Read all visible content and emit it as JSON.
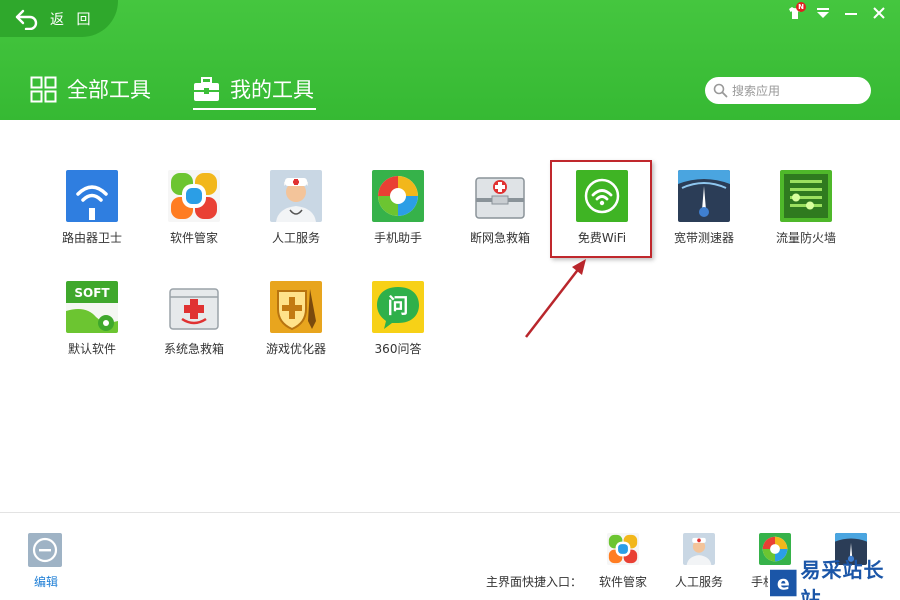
{
  "header": {
    "back_label": "返 回",
    "tabs": [
      {
        "label": "全部工具",
        "active": false
      },
      {
        "label": "我的工具",
        "active": true
      }
    ],
    "search": {
      "placeholder": "搜索应用"
    },
    "notification_badge": "N"
  },
  "tools": [
    {
      "label": "路由器卫士",
      "icon": "router-guard-icon"
    },
    {
      "label": "软件管家",
      "icon": "software-manager-icon"
    },
    {
      "label": "人工服务",
      "icon": "human-service-icon"
    },
    {
      "label": "手机助手",
      "icon": "phone-assistant-icon"
    },
    {
      "label": "断网急救箱",
      "icon": "network-firstaid-icon"
    },
    {
      "label": "免费WiFi",
      "icon": "free-wifi-icon"
    },
    {
      "label": "宽带测速器",
      "icon": "speedtest-icon"
    },
    {
      "label": "流量防火墙",
      "icon": "traffic-firewall-icon"
    },
    {
      "label": "默认软件",
      "icon": "default-software-icon"
    },
    {
      "label": "系统急救箱",
      "icon": "system-firstaid-icon"
    },
    {
      "label": "游戏优化器",
      "icon": "game-optimizer-icon"
    },
    {
      "label": "360问答",
      "icon": "qa-icon"
    }
  ],
  "footer": {
    "edit_label": "编辑",
    "shortcut_prefix": "主界面快捷入口：",
    "shortcuts": [
      {
        "label": "软件管家"
      },
      {
        "label": "人工服务"
      },
      {
        "label": "手机助手"
      }
    ]
  },
  "watermark": {
    "text": "易采站长站"
  },
  "colors": {
    "header_green": "#3cbf38",
    "highlight_red": "#c0282d",
    "link_blue": "#1f7fd6"
  }
}
